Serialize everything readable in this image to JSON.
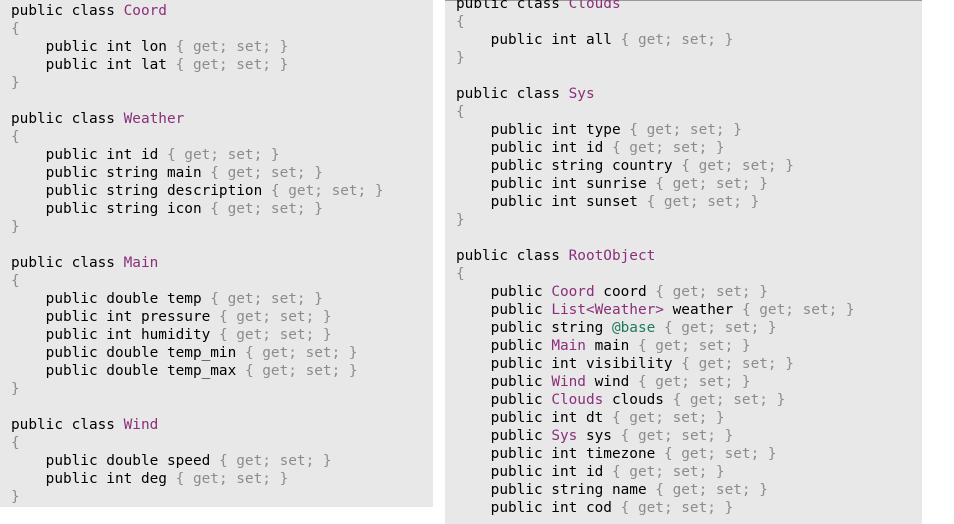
{
  "colors": {
    "panel_background": "#e8e8e8",
    "keyword": "#000000",
    "type_name": "#8b2f7a",
    "verbatim_prefix": "#1f7a5c",
    "punctuation": "#8c8c8c"
  },
  "panels": [
    {
      "id": "panel-left",
      "lines": [
        [
          {
            "t": "public class ",
            "c": "kw"
          },
          {
            "t": "Coord",
            "c": "ty"
          }
        ],
        [
          {
            "t": "{",
            "c": "brace"
          }
        ],
        [
          {
            "t": "    public int lon ",
            "c": "kw"
          },
          {
            "t": "{ get; set; }",
            "c": "acc"
          }
        ],
        [
          {
            "t": "    public int lat ",
            "c": "kw"
          },
          {
            "t": "{ get; set; }",
            "c": "acc"
          }
        ],
        [
          {
            "t": "}",
            "c": "brace"
          }
        ],
        [],
        [
          {
            "t": "public class ",
            "c": "kw"
          },
          {
            "t": "Weather",
            "c": "ty"
          }
        ],
        [
          {
            "t": "{",
            "c": "brace"
          }
        ],
        [
          {
            "t": "    public int id ",
            "c": "kw"
          },
          {
            "t": "{ get; set; }",
            "c": "acc"
          }
        ],
        [
          {
            "t": "    public string main ",
            "c": "kw"
          },
          {
            "t": "{ get; set; }",
            "c": "acc"
          }
        ],
        [
          {
            "t": "    public string description ",
            "c": "kw"
          },
          {
            "t": "{ get; set; }",
            "c": "acc"
          }
        ],
        [
          {
            "t": "    public string icon ",
            "c": "kw"
          },
          {
            "t": "{ get; set; }",
            "c": "acc"
          }
        ],
        [
          {
            "t": "}",
            "c": "brace"
          }
        ],
        [],
        [
          {
            "t": "public class ",
            "c": "kw"
          },
          {
            "t": "Main",
            "c": "ty"
          }
        ],
        [
          {
            "t": "{",
            "c": "brace"
          }
        ],
        [
          {
            "t": "    public double temp ",
            "c": "kw"
          },
          {
            "t": "{ get; set; }",
            "c": "acc"
          }
        ],
        [
          {
            "t": "    public int pressure ",
            "c": "kw"
          },
          {
            "t": "{ get; set; }",
            "c": "acc"
          }
        ],
        [
          {
            "t": "    public int humidity ",
            "c": "kw"
          },
          {
            "t": "{ get; set; }",
            "c": "acc"
          }
        ],
        [
          {
            "t": "    public double temp_min ",
            "c": "kw"
          },
          {
            "t": "{ get; set; }",
            "c": "acc"
          }
        ],
        [
          {
            "t": "    public double temp_max ",
            "c": "kw"
          },
          {
            "t": "{ get; set; }",
            "c": "acc"
          }
        ],
        [
          {
            "t": "}",
            "c": "brace"
          }
        ],
        [],
        [
          {
            "t": "public class ",
            "c": "kw"
          },
          {
            "t": "Wind",
            "c": "ty"
          }
        ],
        [
          {
            "t": "{",
            "c": "brace"
          }
        ],
        [
          {
            "t": "    public double speed ",
            "c": "kw"
          },
          {
            "t": "{ get; set; }",
            "c": "acc"
          }
        ],
        [
          {
            "t": "    public int deg ",
            "c": "kw"
          },
          {
            "t": "{ get; set; }",
            "c": "acc"
          }
        ],
        [
          {
            "t": "}",
            "c": "brace"
          }
        ]
      ]
    },
    {
      "id": "panel-right",
      "lines": [
        [
          {
            "t": "public class ",
            "c": "kw"
          },
          {
            "t": "Clouds",
            "c": "ty"
          }
        ],
        [
          {
            "t": "{",
            "c": "brace"
          }
        ],
        [
          {
            "t": "    public int all ",
            "c": "kw"
          },
          {
            "t": "{ get; set; }",
            "c": "acc"
          }
        ],
        [
          {
            "t": "}",
            "c": "brace"
          }
        ],
        [],
        [
          {
            "t": "public class ",
            "c": "kw"
          },
          {
            "t": "Sys",
            "c": "ty"
          }
        ],
        [
          {
            "t": "{",
            "c": "brace"
          }
        ],
        [
          {
            "t": "    public int type ",
            "c": "kw"
          },
          {
            "t": "{ get; set; }",
            "c": "acc"
          }
        ],
        [
          {
            "t": "    public int id ",
            "c": "kw"
          },
          {
            "t": "{ get; set; }",
            "c": "acc"
          }
        ],
        [
          {
            "t": "    public string country ",
            "c": "kw"
          },
          {
            "t": "{ get; set; }",
            "c": "acc"
          }
        ],
        [
          {
            "t": "    public int sunrise ",
            "c": "kw"
          },
          {
            "t": "{ get; set; }",
            "c": "acc"
          }
        ],
        [
          {
            "t": "    public int sunset ",
            "c": "kw"
          },
          {
            "t": "{ get; set; }",
            "c": "acc"
          }
        ],
        [
          {
            "t": "}",
            "c": "brace"
          }
        ],
        [],
        [
          {
            "t": "public class ",
            "c": "kw"
          },
          {
            "t": "RootObject",
            "c": "ty"
          }
        ],
        [
          {
            "t": "{",
            "c": "brace"
          }
        ],
        [
          {
            "t": "    public ",
            "c": "kw"
          },
          {
            "t": "Coord",
            "c": "ty"
          },
          {
            "t": " coord ",
            "c": "kw"
          },
          {
            "t": "{ get; set; }",
            "c": "acc"
          }
        ],
        [
          {
            "t": "    public ",
            "c": "kw"
          },
          {
            "t": "List<Weather>",
            "c": "ty"
          },
          {
            "t": " weather ",
            "c": "kw"
          },
          {
            "t": "{ get; set; }",
            "c": "acc"
          }
        ],
        [
          {
            "t": "    public string ",
            "c": "kw"
          },
          {
            "t": "@base",
            "c": "at"
          },
          {
            "t": " ",
            "c": "kw"
          },
          {
            "t": "{ get; set; }",
            "c": "acc"
          }
        ],
        [
          {
            "t": "    public ",
            "c": "kw"
          },
          {
            "t": "Main",
            "c": "ty"
          },
          {
            "t": " main ",
            "c": "kw"
          },
          {
            "t": "{ get; set; }",
            "c": "acc"
          }
        ],
        [
          {
            "t": "    public int visibility ",
            "c": "kw"
          },
          {
            "t": "{ get; set; }",
            "c": "acc"
          }
        ],
        [
          {
            "t": "    public ",
            "c": "kw"
          },
          {
            "t": "Wind",
            "c": "ty"
          },
          {
            "t": " wind ",
            "c": "kw"
          },
          {
            "t": "{ get; set; }",
            "c": "acc"
          }
        ],
        [
          {
            "t": "    public ",
            "c": "kw"
          },
          {
            "t": "Clouds",
            "c": "ty"
          },
          {
            "t": " clouds ",
            "c": "kw"
          },
          {
            "t": "{ get; set; }",
            "c": "acc"
          }
        ],
        [
          {
            "t": "    public int dt ",
            "c": "kw"
          },
          {
            "t": "{ get; set; }",
            "c": "acc"
          }
        ],
        [
          {
            "t": "    public ",
            "c": "kw"
          },
          {
            "t": "Sys",
            "c": "ty"
          },
          {
            "t": " sys ",
            "c": "kw"
          },
          {
            "t": "{ get; set; }",
            "c": "acc"
          }
        ],
        [
          {
            "t": "    public int timezone ",
            "c": "kw"
          },
          {
            "t": "{ get; set; }",
            "c": "acc"
          }
        ],
        [
          {
            "t": "    public int id ",
            "c": "kw"
          },
          {
            "t": "{ get; set; }",
            "c": "acc"
          }
        ],
        [
          {
            "t": "    public string name ",
            "c": "kw"
          },
          {
            "t": "{ get; set; }",
            "c": "acc"
          }
        ],
        [
          {
            "t": "    public int cod ",
            "c": "kw"
          },
          {
            "t": "{ get; set; }",
            "c": "acc"
          }
        ]
      ]
    }
  ]
}
